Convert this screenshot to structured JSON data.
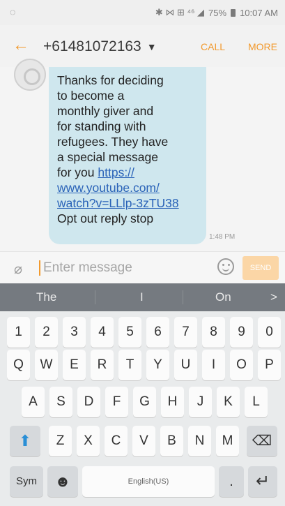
{
  "status": {
    "time": "10:07 AM",
    "battery": "75%",
    "left_icon": "whatsapp-icon",
    "misc": "✱ ⋈ ⊞ ⁴⁶ ◢"
  },
  "header": {
    "back_icon": "arrow-left-icon",
    "contact": "+61481072163",
    "caret": "▼",
    "call": "CALL",
    "more": "MORE"
  },
  "message": {
    "line1": "Thanks for deciding",
    "line2": "to become a",
    "line3": "monthly giver and",
    "line4": "for standing with",
    "line5": "refugees. They have",
    "line6": "a special message",
    "line7_text": "for you ",
    "link1": "https://",
    "link2": "www.youtube.com/",
    "link3": "watch?v=LLlp-3zTU38",
    "line_end": "Opt out reply stop",
    "time": "1:48 PM"
  },
  "input": {
    "placeholder": "Enter message",
    "send": "SEND"
  },
  "suggestions": {
    "s1": "The",
    "s2": "I",
    "s3": "On",
    "arrow": ">"
  },
  "keyboard": {
    "row1": [
      "1",
      "2",
      "3",
      "4",
      "5",
      "6",
      "7",
      "8",
      "9",
      "0"
    ],
    "row2": [
      "Q",
      "W",
      "E",
      "R",
      "T",
      "Y",
      "U",
      "I",
      "O",
      "P"
    ],
    "row3": [
      "A",
      "S",
      "D",
      "F",
      "G",
      "H",
      "J",
      "K",
      "L"
    ],
    "row4": [
      "Z",
      "X",
      "C",
      "V",
      "B",
      "N",
      "M"
    ],
    "shift": "⬆",
    "backspace": "⌫",
    "sym": "Sym",
    "emoji": "☻",
    "space": "English(US)",
    "period": ".",
    "enter": "↵"
  }
}
